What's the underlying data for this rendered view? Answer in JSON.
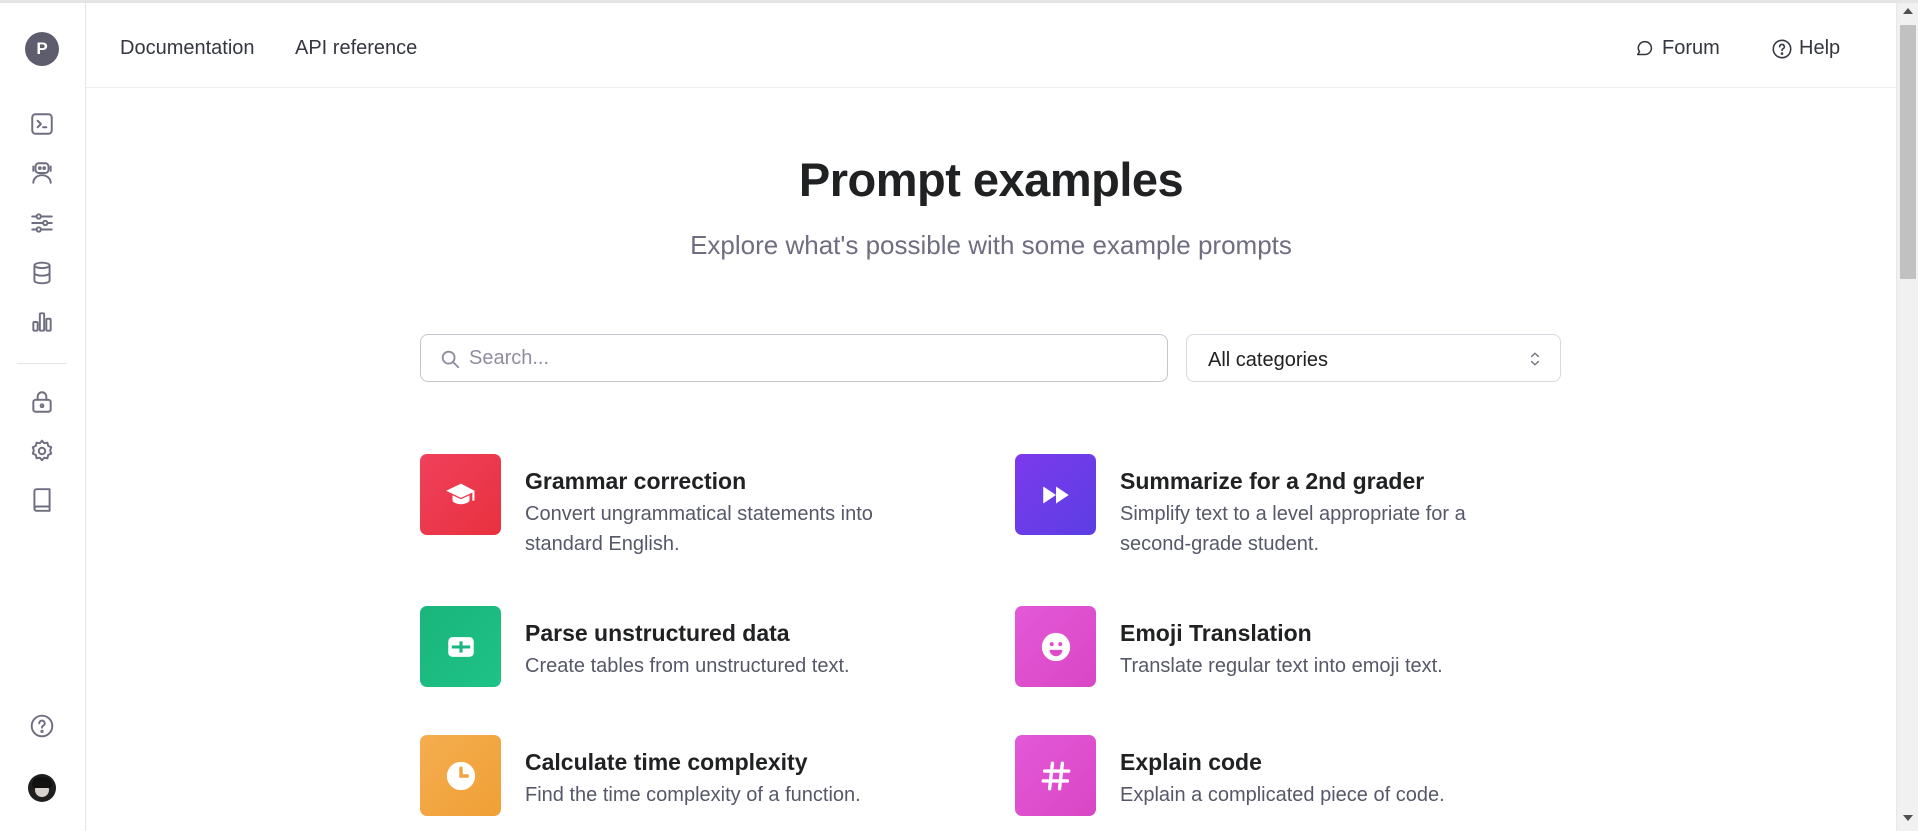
{
  "sidebar": {
    "org_initial": "P",
    "items": [
      {
        "name": "playground",
        "icon": "terminal-icon"
      },
      {
        "name": "assistants",
        "icon": "robot-icon"
      },
      {
        "name": "fine-tuning",
        "icon": "sliders-icon"
      },
      {
        "name": "storage",
        "icon": "database-icon"
      },
      {
        "name": "usage",
        "icon": "bar-chart-icon"
      },
      {
        "name": "api-keys",
        "icon": "lock-icon"
      },
      {
        "name": "settings",
        "icon": "gear-icon"
      },
      {
        "name": "docs",
        "icon": "book-icon"
      },
      {
        "name": "help",
        "icon": "question-icon"
      }
    ]
  },
  "header": {
    "nav": [
      "Documentation",
      "API reference"
    ],
    "forum_label": "Forum",
    "help_label": "Help"
  },
  "main": {
    "title": "Prompt examples",
    "subtitle": "Explore what's possible with some example prompts",
    "search_placeholder": "Search...",
    "category_value": "All categories"
  },
  "examples": [
    {
      "title": "Grammar correction",
      "description": "Convert ungrammatical statements into standard English.",
      "icon": "graduation-cap-icon",
      "color_from": "#f0405b",
      "color_to": "#e8313f"
    },
    {
      "title": "Summarize for a 2nd grader",
      "description": "Simplify text to a level appropriate for a second-grade student.",
      "icon": "fast-forward-icon",
      "color_from": "#7c3aed",
      "color_to": "#5b3ee3"
    },
    {
      "title": "Parse unstructured data",
      "description": "Create tables from unstructured text.",
      "icon": "table-icon",
      "color_from": "#19b57c",
      "color_to": "#1fc287"
    },
    {
      "title": "Emoji Translation",
      "description": "Translate regular text into emoji text.",
      "icon": "smiley-icon",
      "color_from": "#e359d8",
      "color_to": "#d946c4"
    },
    {
      "title": "Calculate time complexity",
      "description": "Find the time complexity of a function.",
      "icon": "clock-icon",
      "color_from": "#f4ad4f",
      "color_to": "#f0a035"
    },
    {
      "title": "Explain code",
      "description": "Explain a complicated piece of code.",
      "icon": "hash-icon",
      "color_from": "#e359d8",
      "color_to": "#d946c4"
    }
  ]
}
